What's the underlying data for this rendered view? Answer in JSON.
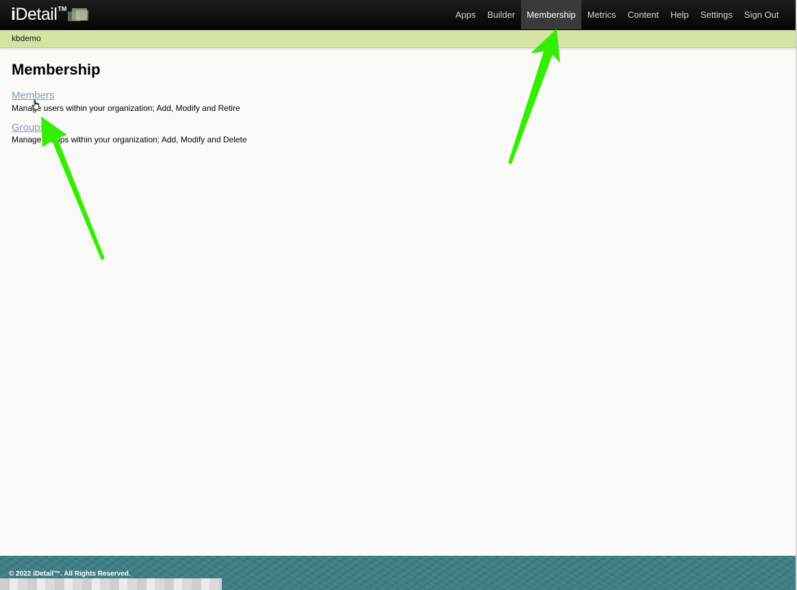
{
  "app": {
    "logo_text_bold": "i",
    "logo_text_rest": "Detail",
    "logo_tm": "TM"
  },
  "nav": {
    "items": [
      {
        "label": "Apps"
      },
      {
        "label": "Builder"
      },
      {
        "label": "Membership",
        "active": true
      },
      {
        "label": "Metrics"
      },
      {
        "label": "Content"
      },
      {
        "label": "Help"
      },
      {
        "label": "Settings"
      },
      {
        "label": "Sign Out"
      }
    ]
  },
  "org": {
    "name": "kbdemo"
  },
  "main": {
    "title": "Membership",
    "sections": [
      {
        "link": "Members",
        "description": "Manage users within your organization; Add, Modify and Retire"
      },
      {
        "link": "Groups",
        "description": "Manage groups within your organization; Add, Modify and Delete"
      }
    ]
  },
  "footer": {
    "copyright": "© 2022 iDetail™.  All Rights Reserved."
  },
  "colors": {
    "accent_bar": "#d3e4a3",
    "link": "#7b9bb5",
    "footer": "#3f7f86",
    "annotation_arrow": "#33ee00"
  },
  "icons": {
    "logo": "stacked-squares-icon",
    "cursor": "hand-pointer-icon",
    "annotation": "arrow-icon"
  }
}
